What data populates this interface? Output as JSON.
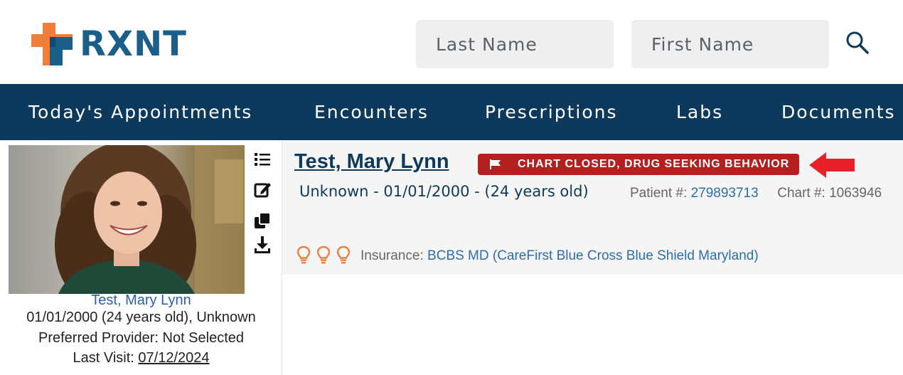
{
  "header": {
    "logo_text": "RXNT",
    "search": {
      "last_name_placeholder": "Last Name",
      "first_name_placeholder": "First Name"
    }
  },
  "nav": {
    "items": [
      {
        "label": "Today's Appointments"
      },
      {
        "label": "Encounters"
      },
      {
        "label": "Prescriptions"
      },
      {
        "label": "Labs"
      },
      {
        "label": "Documents"
      }
    ]
  },
  "sidebar": {
    "patient_name": "Test, Mary Lynn",
    "dob_line": "01/01/2000 (24 years old), Unknown",
    "preferred_provider_line": "Preferred Provider: Not Selected",
    "last_visit_label": "Last Visit:",
    "last_visit_date": "07/12/2024"
  },
  "patient": {
    "name": "Test, Mary Lynn",
    "flag_text": "CHART CLOSED, DRUG SEEKING BEHAVIOR",
    "demographics": "Unknown - 01/01/2000 - (24 years old)",
    "patient_number_label": "Patient #:",
    "patient_number": "279893713",
    "chart_number_label": "Chart #:",
    "chart_number": "1063946",
    "insurance_label": "Insurance:",
    "insurance_value": "BCBS MD (CareFirst Blue Cross Blue Shield Maryland)"
  },
  "colors": {
    "brand_blue": "#1a5e8a",
    "brand_orange": "#f07f3c",
    "nav_bg": "#0d3a5c",
    "flag_red": "#b3201f",
    "arrow_red": "#e8202a",
    "link_blue": "#2b6db0",
    "bulb_orange": "#f07f3c"
  },
  "icons": {
    "logo": "rxnt-cross-logo",
    "search": "search-icon",
    "list": "list-icon",
    "edit": "edit-icon",
    "copy": "copy-icon",
    "download": "download-icon",
    "flag": "flag-icon",
    "bulb": "lightbulb-icon"
  }
}
